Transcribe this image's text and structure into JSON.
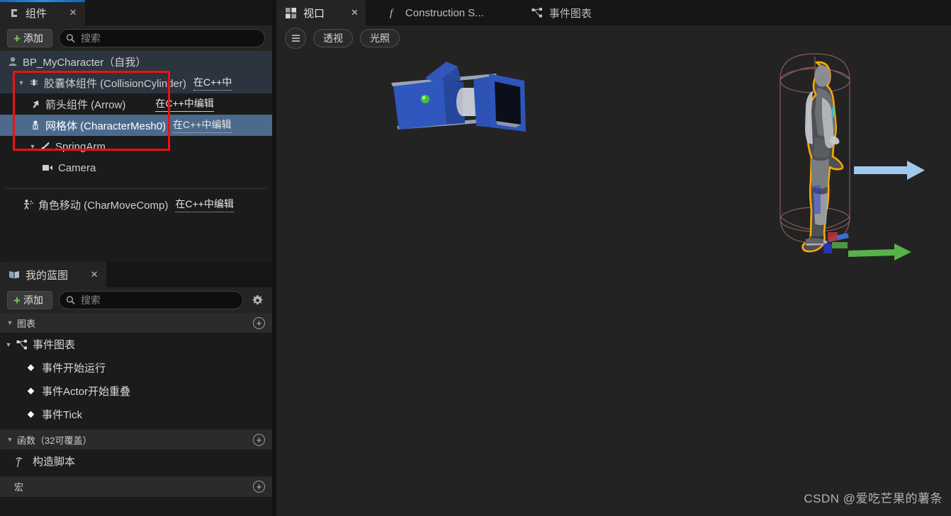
{
  "left_panel": {
    "components_tab": {
      "label": "组件",
      "icon": "components-icon",
      "close": "✕"
    },
    "toolbar": {
      "add_label": "添加",
      "add_icon": "plus-icon",
      "search_placeholder": "搜索",
      "search_icon": "search-icon"
    },
    "tree": [
      {
        "label": "BP_MyCharacter（自我）",
        "icon": "actor-icon",
        "indent": 0,
        "twisty": "",
        "link": "",
        "state": "header"
      },
      {
        "label": "胶囊体组件 (CollisionCylinder)",
        "icon": "capsule-icon",
        "indent": 1,
        "twisty": "▼",
        "link": "在C++中",
        "state": "header"
      },
      {
        "label": "箭头组件 (Arrow)",
        "icon": "arrow-icon",
        "indent": 2,
        "twisty": "",
        "link": "在C++中编辑",
        "state": "normal"
      },
      {
        "label": "网格体 (CharacterMesh0)",
        "icon": "mesh-icon",
        "indent": 2,
        "twisty": "",
        "link": "在C++中编辑",
        "state": "selected"
      },
      {
        "label": "SpringArm",
        "icon": "springarm-icon",
        "indent": 2,
        "twisty": "▼",
        "link": "",
        "state": "normal"
      },
      {
        "label": "Camera",
        "icon": "camera-icon",
        "indent": 3,
        "twisty": "",
        "link": "",
        "state": "normal"
      },
      {
        "label": "角色移动 (CharMoveComp)",
        "icon": "charmove-icon",
        "indent": 1,
        "twisty": "",
        "link": "在C++中编辑",
        "state": "normal"
      }
    ],
    "annotation": {
      "color": "#ee1111",
      "name": "red-highlight-box"
    }
  },
  "blueprint_panel": {
    "tab": {
      "label": "我的蓝图",
      "icon": "book-icon",
      "close": "✕"
    },
    "toolbar": {
      "add_label": "添加",
      "add_icon": "plus-icon",
      "search_placeholder": "搜索",
      "search_icon": "search-icon",
      "settings_icon": "gear-icon"
    },
    "sections": [
      {
        "title": "图表",
        "twisty": "▼",
        "add": "+"
      },
      {
        "title": "函数（32可覆盖）",
        "twisty": "▼",
        "add": "+"
      },
      {
        "title": "宏",
        "twisty": "",
        "add": "+"
      }
    ],
    "graph_root": {
      "label": "事件图表",
      "icon": "eventgraph-icon",
      "twisty": "▼"
    },
    "graph_items": [
      {
        "label": "事件开始运行",
        "icon": "event-node-icon"
      },
      {
        "label": "事件Actor开始重叠",
        "icon": "event-node-icon"
      },
      {
        "label": "事件Tick",
        "icon": "event-node-icon"
      }
    ],
    "function_items": [
      {
        "label": "构造脚本",
        "icon": "function-icon"
      }
    ]
  },
  "viewport": {
    "tabs": [
      {
        "label": "视口",
        "icon": "viewport-icon",
        "active": true,
        "close": "✕"
      },
      {
        "label": "Construction S...",
        "icon": "function-icon",
        "active": false,
        "close": ""
      },
      {
        "label": "事件图表",
        "icon": "eventgraph-icon",
        "active": false,
        "close": ""
      }
    ],
    "toolbar": [
      {
        "label": "",
        "name": "viewport-menu-button",
        "icon": "hamburger-icon"
      },
      {
        "label": "透视",
        "name": "perspective-button",
        "icon": ""
      },
      {
        "label": "光照",
        "name": "lighting-button",
        "icon": ""
      }
    ],
    "scene": {
      "camera_mesh_color": "#2b4fa8",
      "camera_led_color": "#44cc33",
      "selection_outline_color": "#ffa800",
      "capsule_wire_color": "#8b5a5a",
      "gizmo_x_color": "#57b24a",
      "gizmo_y_color": "#9fc8ef",
      "gizmo_z_color": "#3a6fd8",
      "background_color": "#232323"
    },
    "watermark": "CSDN @爱吃芒果的薯条"
  }
}
